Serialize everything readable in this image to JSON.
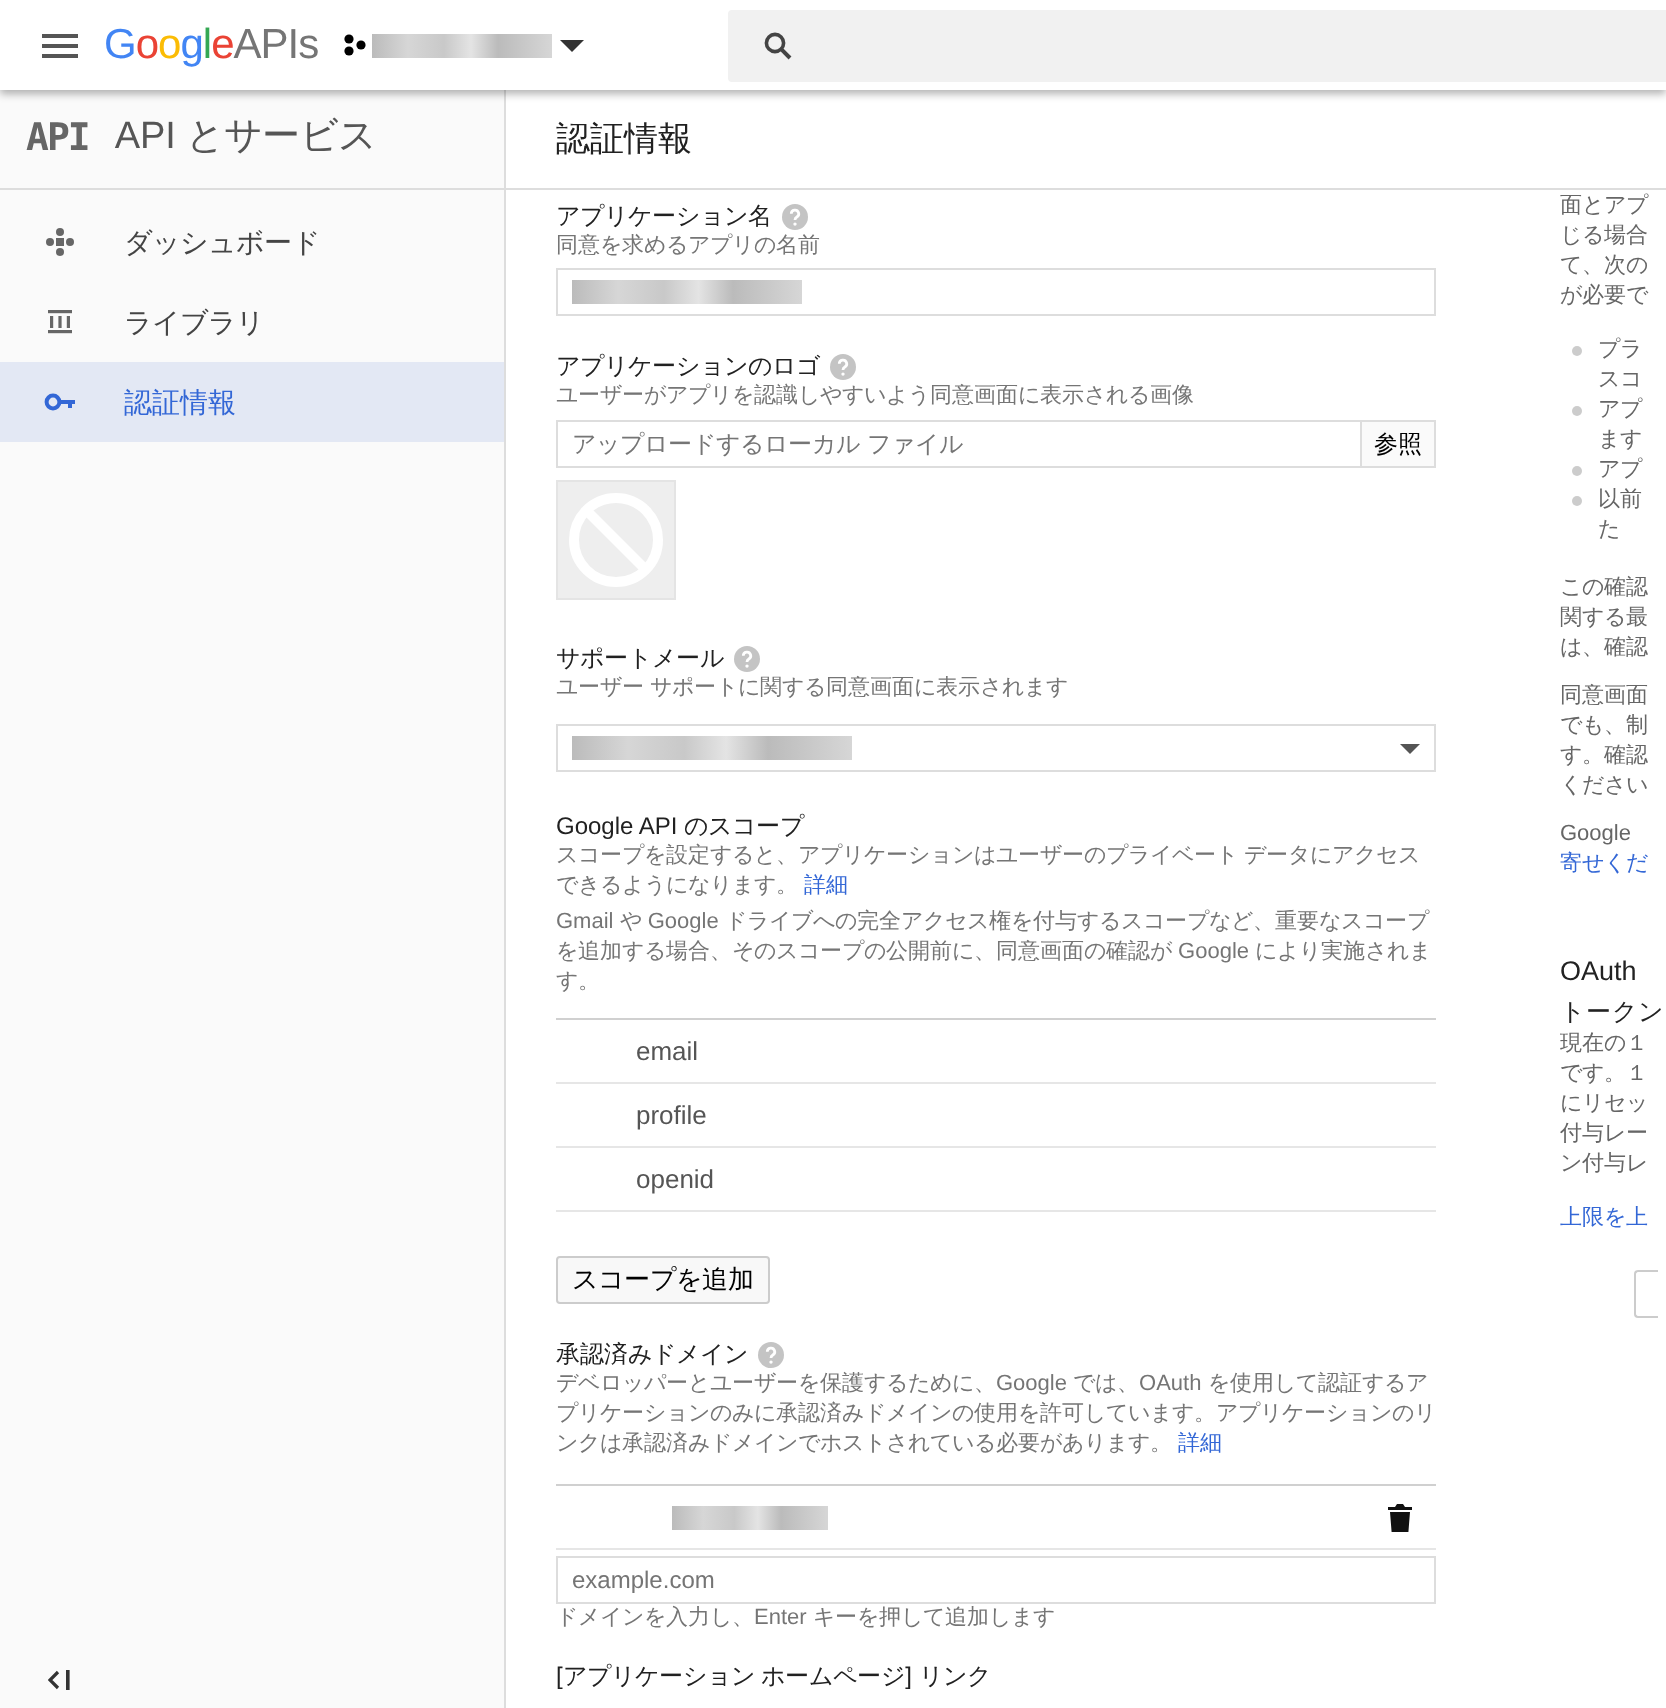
{
  "header": {
    "brand": "Google",
    "product": "APIs",
    "project": {
      "redacted": true
    }
  },
  "sidebar": {
    "logo_text": "API",
    "title": "API とサービス",
    "items": [
      {
        "label": "ダッシュボード",
        "kind": "dashboard",
        "selected": false
      },
      {
        "label": "ライブラリ",
        "kind": "library",
        "selected": false
      },
      {
        "label": "認証情報",
        "kind": "key",
        "selected": true
      }
    ]
  },
  "page_title": "認証情報",
  "app_name": {
    "label": "アプリケーション名",
    "help": true,
    "description": "同意を求めるアプリの名前",
    "redacted": true
  },
  "logo": {
    "label": "アプリケーションのロゴ",
    "help": true,
    "description": "ユーザーがアプリを認識しやすいよう同意画面に表示される画像",
    "placeholder": "アップロードするローカル ファイル",
    "button": "参照"
  },
  "support_email": {
    "label": "サポートメール",
    "help": true,
    "description": "ユーザー サポートに関する同意画面に表示されます",
    "redacted": true
  },
  "scopes": {
    "title": "Google API のスコープ",
    "description": "スコープを設定すると、アプリケーションはユーザーのプライベート データにアクセスできるようになります。",
    "link": "詳細",
    "note": "Gmail や Google ドライブへの完全アクセス権を付与するスコープなど、重要なスコープを追加する場合、そのスコープの公開前に、同意画面の確認が Google により実施されます。",
    "items": [
      "email",
      "profile",
      "openid"
    ],
    "add_button": "スコープを追加"
  },
  "domains": {
    "label": "承認済みドメイン",
    "help": true,
    "description": "デベロッパーとユーザーを保護するために、Google では、OAuth を使用して認証するアプリケーションのみに承認済みドメインの使用を許可しています。アプリケーションのリンクは承認済みドメインでホストされている必要があります。",
    "link": "詳細",
    "entries": [
      {
        "redacted": true
      }
    ],
    "placeholder": "example.com",
    "hint": "ドメインを入力し、Enter キーを押して追加します"
  },
  "homepage_link": {
    "label": "[アプリケーション ホームページ] リンク"
  },
  "side_panel": {
    "blocks": [
      {
        "kind": "text",
        "lines": [
          "面とアプ",
          "じる場合",
          "て、次の",
          "が必要で"
        ]
      },
      {
        "kind": "bullets",
        "items": [
          [
            "プラ",
            "スコ"
          ],
          [
            "アプ",
            "ます"
          ],
          [
            "アプ"
          ],
          [
            "以前",
            "た"
          ]
        ]
      },
      {
        "kind": "text",
        "lines": [
          "この確認",
          "関する最",
          "は、確認"
        ]
      },
      {
        "kind": "text",
        "lines": [
          "同意画面",
          "でも、制",
          "す。確認",
          "ください"
        ]
      },
      {
        "kind": "text_link",
        "lines": [
          "Google"
        ],
        "link": "寄せくだ"
      },
      {
        "kind": "heading",
        "text": "OAuth"
      },
      {
        "kind": "subheading",
        "text": "トークン"
      },
      {
        "kind": "text",
        "lines": [
          "現在の１",
          "です。１",
          "にリセッ",
          "付与レー",
          "ン付与レ"
        ]
      },
      {
        "kind": "link",
        "text": "上限を上"
      },
      {
        "kind": "button_edge"
      }
    ]
  }
}
